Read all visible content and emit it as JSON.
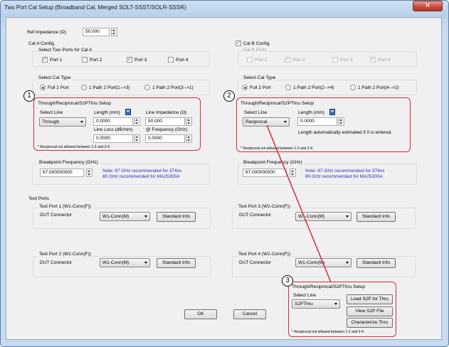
{
  "window": {
    "title": "Two Port Cal Setup (Broadband Cal, Merged SOLT-SSST/SOLR-SSSR)",
    "close_icon": "close-x-icon"
  },
  "ref_impedance": {
    "label": "Ref Impedance (Ω)",
    "value": "50.000"
  },
  "cal_a": {
    "title": "Cal A Config.",
    "select_ports_label": "Select Two Ports for Cal A",
    "ports": [
      {
        "label": "Port 1",
        "checked": true
      },
      {
        "label": "Port 2",
        "checked": false
      },
      {
        "label": "Port 3",
        "checked": true
      },
      {
        "label": "Port 4",
        "checked": false
      }
    ],
    "cal_type_label": "Select Cal Type",
    "cal_types": [
      {
        "label": "Full 2 Port",
        "selected": true
      },
      {
        "label": "1 Path 2 Port(1-->3)",
        "selected": false
      },
      {
        "label": "1 Path 2 Port(3-->1)",
        "selected": false
      }
    ],
    "thru": {
      "title": "Through/Reciprocal/S2PThru Setup",
      "select_line_label": "Select Line",
      "select_line_value": "Through",
      "length_label": "Length (mm)",
      "length_value": "0.0000",
      "line_impedance_label": "Line Impedance (Ω)",
      "line_impedance_value": "50.000",
      "line_loss_label": "Line Loss (dB/mm)",
      "line_loss_value": "0.0000",
      "frequency_label": "@ Frequency (GHz)",
      "frequency_value": "0.0000",
      "footnote": "* Reciprocal not allowed between 1-2 and 3-4."
    },
    "breakpoint": {
      "label": "Breakpoint Frequency (GHz)",
      "value": "67.000000000",
      "note_line1": "Note: 67 GHz recommended for 374xx",
      "note_line2": "80 GHz recommended for MA25300A"
    }
  },
  "cal_b": {
    "title": "Cal B Config.",
    "checked": true,
    "select_ports_label": "Cal B Ports",
    "ports": [
      {
        "label": "Port 1",
        "checked": false
      },
      {
        "label": "Port 2",
        "checked": true
      },
      {
        "label": "Port 3",
        "checked": false
      },
      {
        "label": "Port 4",
        "checked": true
      }
    ],
    "cal_type_label": "Select Cal Type",
    "cal_types": [
      {
        "label": "Full 2 Port",
        "selected": true
      },
      {
        "label": "1 Path 2 Port(2-->4)",
        "selected": false
      },
      {
        "label": "1 Path 2 Port(4-->2)",
        "selected": false
      }
    ],
    "thru": {
      "title": "Through/Reciprocal/S2PThru Setup",
      "select_line_label": "Select Line",
      "select_line_value": "Reciprocal",
      "length_label": "Length (mm)",
      "length_value": "0.0000",
      "auto_note": "Length automatically estimated if 0 is entered.",
      "footnote": "* Reciprocal not allowed between 1-2 and 3-4."
    },
    "breakpoint": {
      "label": "Breakpoint Frequency (GHz)",
      "value": "67.000000000",
      "note_line1": "Note: 67 GHz recommended for 374xx",
      "note_line2": "80 GHz recommended for MA25300A"
    }
  },
  "test_ports": {
    "title": "Test Ports",
    "ports": [
      {
        "title": "Test Port 1 (W1-Conn(F))",
        "dut_label": "DUT Connector",
        "connector": "W1-Conn(M)",
        "info_button": "Standard Info"
      },
      {
        "title": "Test Port 3 (W1-Conn(F))",
        "dut_label": "DUT Connector",
        "connector": "W1-Conn(M)",
        "info_button": "Standard Info"
      },
      {
        "title": "Test Port 2 (W1-Conn(F))",
        "dut_label": "DUT Connector",
        "connector": "W1-Conn(M)",
        "info_button": "Standard Info"
      },
      {
        "title": "Test Port 4 (W1-Conn(F))",
        "dut_label": "DUT Connector",
        "connector": "W1-Conn(M)",
        "info_button": "Standard Info"
      }
    ]
  },
  "buttons": {
    "ok": "OK",
    "cancel": "Cancel"
  },
  "popup": {
    "title": "Through/Reciprocal/S2PThru Setup",
    "select_line_label": "Select Line",
    "select_line_value": "S2PThru",
    "load_button": "Load S2P for Thru",
    "view_button": "View S2P File",
    "characterize_button": "Characterize Thru",
    "footnote": "* Reciprocal not allowed between 1-2 and 3-4."
  },
  "callouts": [
    "1",
    "2",
    "3"
  ],
  "colors": {
    "highlight": "#d42b3c",
    "note": "#2030c0"
  }
}
